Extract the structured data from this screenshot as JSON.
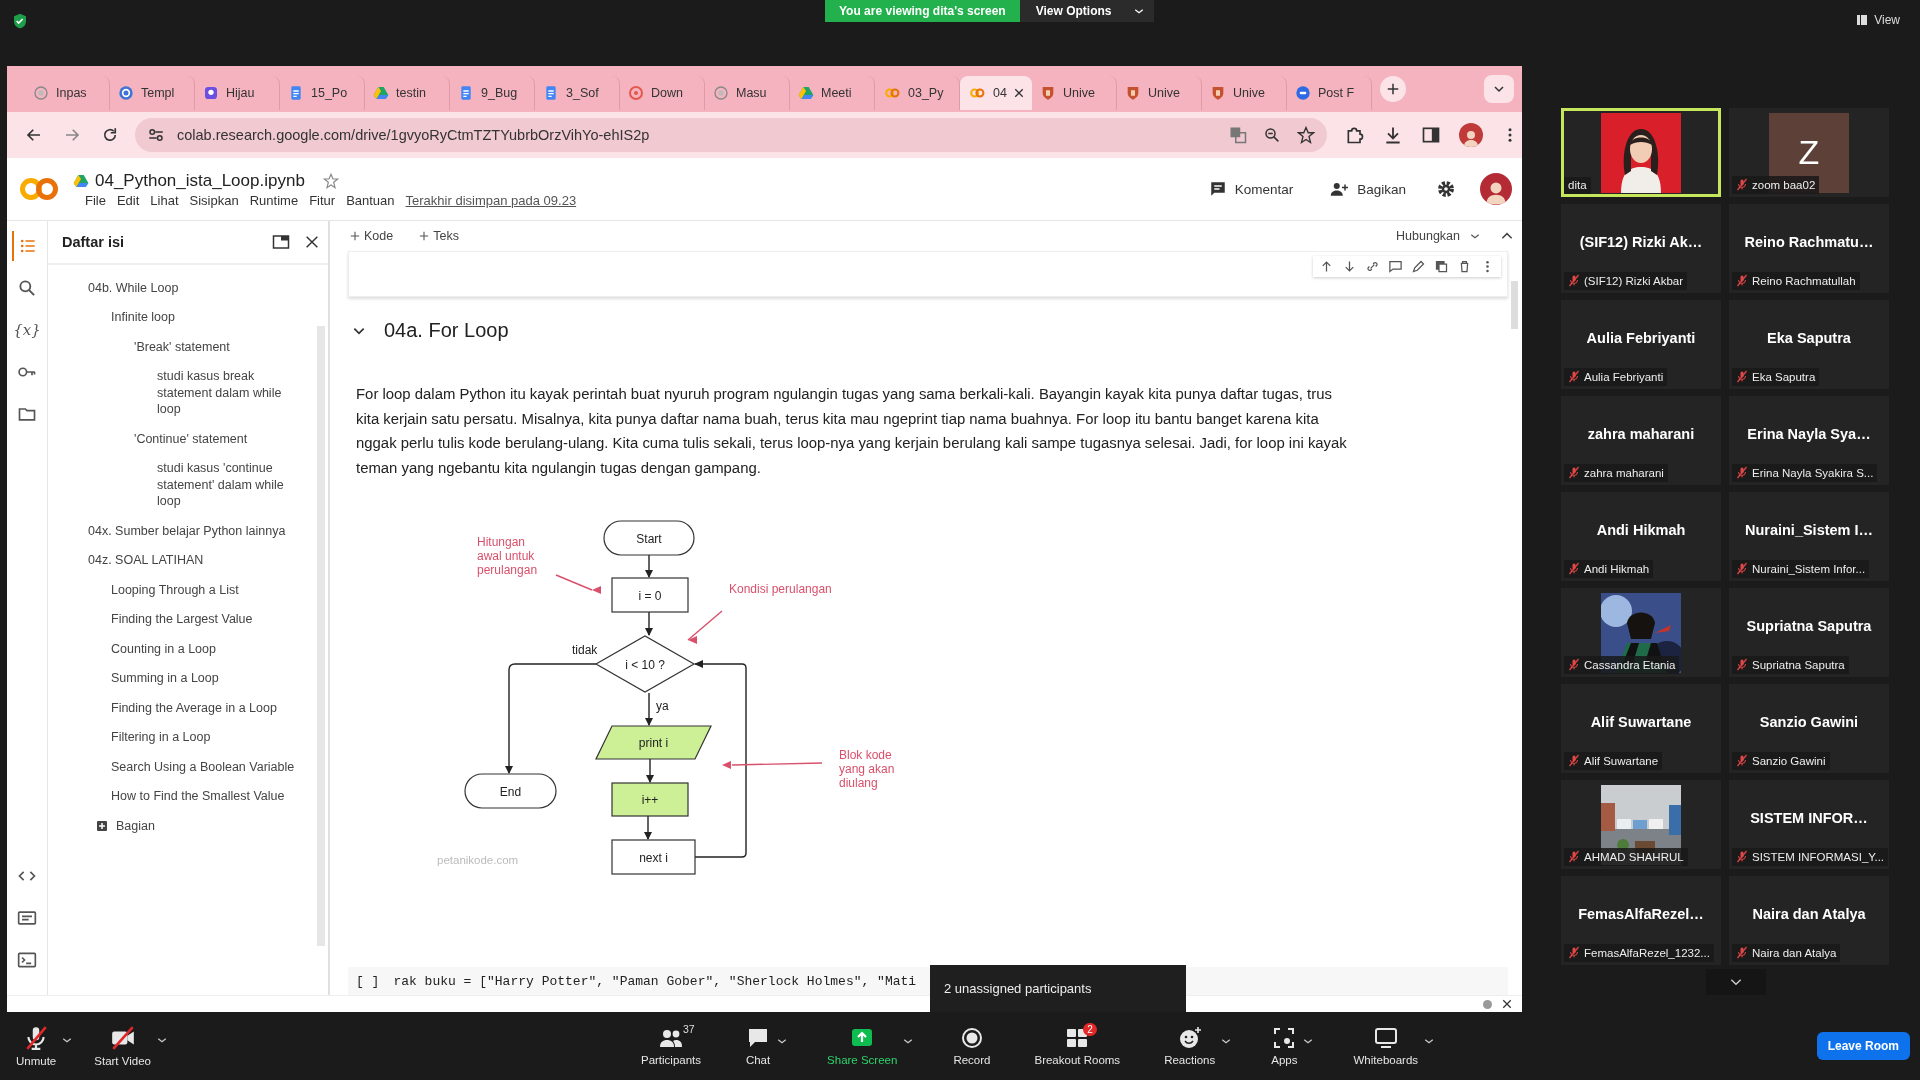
{
  "zoom_bar": {
    "banner": "You are viewing dita's screen",
    "view_options": "View Options",
    "view": "View"
  },
  "browser": {
    "tabs": [
      {
        "kind": "site",
        "label": "Inpas",
        "selected": false
      },
      {
        "kind": "circle",
        "label": "Templ",
        "selected": false
      },
      {
        "kind": "badge",
        "label": "Hijau",
        "selected": false
      },
      {
        "kind": "document",
        "label": "15_Po",
        "selected": false
      },
      {
        "kind": "drive",
        "label": "testin",
        "selected": false
      },
      {
        "kind": "document",
        "label": "9_Bug",
        "selected": false
      },
      {
        "kind": "document",
        "label": "3_Sof",
        "selected": false
      },
      {
        "kind": "ring",
        "label": "Down",
        "selected": false
      },
      {
        "kind": "site",
        "label": "Masu",
        "selected": false
      },
      {
        "kind": "drive",
        "label": "Meeti",
        "selected": false
      },
      {
        "kind": "notebook",
        "label": "03_Py",
        "selected": false
      },
      {
        "kind": "notebook",
        "label": "04",
        "selected": true
      },
      {
        "kind": "shield",
        "label": "Unive",
        "selected": false
      },
      {
        "kind": "shield",
        "label": "Unive",
        "selected": false
      },
      {
        "kind": "shield",
        "label": "Unive",
        "selected": false
      },
      {
        "kind": "meeting",
        "label": "Post F",
        "selected": false
      }
    ],
    "url": "colab.research.google.com/drive/1gvyoRyCtmTZTYubrbOrzVihYo-ehIS2p"
  },
  "notebook": {
    "title": "04_Python_ista_Loop.ipynb",
    "menu": [
      "File",
      "Edit",
      "Lihat",
      "Sisipkan",
      "Runtime",
      "Fitur",
      "Bantuan"
    ],
    "saved": "Terakhir disimpan pada 09.23",
    "comment": "Komentar",
    "share": "Bagikan",
    "add_buttons": [
      "Kode",
      "Teks"
    ],
    "connect": "Hubungkan"
  },
  "sidebar": {
    "rail": [
      {
        "kind": "toc",
        "selected": true
      },
      {
        "kind": "search",
        "selected": false
      },
      {
        "kind": "variables",
        "glyph": "{x}",
        "selected": false
      },
      {
        "kind": "secrets",
        "selected": false
      },
      {
        "kind": "files",
        "selected": false
      },
      {
        "kind": "snippets",
        "selected": false
      },
      {
        "kind": "palette",
        "selected": false
      },
      {
        "kind": "terminal",
        "selected": false
      }
    ],
    "title": "Daftar isi",
    "items": [
      {
        "label": "04b. While Loop",
        "children": [
          {
            "label": "Infinite loop",
            "children": [
              {
                "label": "'Break' statement",
                "children": [
                  {
                    "label": "studi kasus break statement dalam while loop"
                  }
                ]
              },
              {
                "label": "'Continue' statement",
                "children": [
                  {
                    "label": "studi kasus 'continue statement' dalam while loop"
                  }
                ]
              }
            ]
          }
        ]
      },
      {
        "label": "04x. Sumber belajar Python lainnya"
      },
      {
        "label": "04z. SOAL LATIHAN",
        "children": [
          {
            "label": "Looping Through a List"
          },
          {
            "label": "Finding the Largest Value"
          },
          {
            "label": "Counting in a Loop"
          },
          {
            "label": "Summing in a Loop"
          },
          {
            "label": "Finding the Average in a Loop"
          },
          {
            "label": "Filtering in a Loop"
          },
          {
            "label": "Search Using a Boolean Variable"
          },
          {
            "label": "How to Find the Smallest Value"
          }
        ]
      }
    ],
    "add_section": "Bagian"
  },
  "section": {
    "heading": "04a. For Loop",
    "expanded": true,
    "paragraph": "For loop dalam Python itu kayak perintah buat nyuruh program ngulangin tugas yang sama berkali-kali. Bayangin kayak kita punya daftar tugas, trus kita kerjain satu persatu. Misalnya, kita punya daftar nama buah, terus kita mau ngeprint tiap nama buahnya. For loop itu bantu banget karena kita nggak perlu tulis kode berulang-ulang. Kita cuma tulis sekali, terus loop-nya yang kerjain berulang kali sampe tugasnya selesai. Jadi, for loop ini kayak teman yang ngebantu kita ngulangin tugas dengan gampang.",
    "diagram": {
      "nodes": [
        {
          "kind": "terminal",
          "label": "Start",
          "highlighted": false
        },
        {
          "kind": "process",
          "label": "i = 0",
          "highlighted": false
        },
        {
          "kind": "decision",
          "label": "i < 10 ?",
          "highlighted": false
        },
        {
          "kind": "io",
          "label": "print i",
          "highlighted": true
        },
        {
          "kind": "process",
          "label": "i++",
          "highlighted": true
        },
        {
          "kind": "process",
          "label": "next i",
          "highlighted": false
        },
        {
          "kind": "terminal",
          "label": "End",
          "highlighted": false
        }
      ],
      "branch_labels": [
        "tidak",
        "ya"
      ],
      "notes": [
        {
          "lines": [
            "Hitungan",
            "awal untuk",
            "perulangan"
          ]
        },
        {
          "lines": [
            "Kondisi perulangan"
          ]
        },
        {
          "lines": [
            "Blok kode",
            "yang akan",
            "diulang"
          ]
        }
      ],
      "credit": "petanikode.com"
    },
    "code": {
      "prompt": "[ ]",
      "text": "rak buku = [\"Harry Potter\", \"Paman Gober\", \"Sherlock Holmes\", \"Mati"
    }
  },
  "participants": [
    {
      "kind": "picture",
      "label": "dita",
      "selected": true,
      "muted": false
    },
    {
      "kind": "letter",
      "display": "Z",
      "label": "zoom baa02",
      "selected": false,
      "muted": true
    },
    {
      "kind": "name",
      "display": "(SIF12) Rizki Ak…",
      "label": "(SIF12) Rizki Akbar",
      "selected": false,
      "muted": true
    },
    {
      "kind": "name",
      "display": "Reino Rachmatu…",
      "label": "Reino Rachmatullah",
      "selected": false,
      "muted": true
    },
    {
      "kind": "name",
      "display": "Aulia Febriyanti",
      "label": "Aulia Febriyanti",
      "selected": false,
      "muted": true
    },
    {
      "kind": "name",
      "display": "Eka Saputra",
      "label": "Eka Saputra",
      "selected": false,
      "muted": true
    },
    {
      "kind": "name",
      "display": "zahra maharani",
      "label": "zahra maharani",
      "selected": false,
      "muted": true
    },
    {
      "kind": "name",
      "display": "Erina Nayla Sya…",
      "label": "Erina Nayla Syakira S...",
      "selected": false,
      "muted": true
    },
    {
      "kind": "name",
      "display": "Andi Hikmah",
      "label": "Andi Hikmah",
      "selected": false,
      "muted": true
    },
    {
      "kind": "name",
      "display": "Nuraini_Sistem I…",
      "label": "Nuraini_Sistem Infor...",
      "selected": false,
      "muted": true
    },
    {
      "kind": "picture",
      "label": "Cassandra Etania",
      "selected": false,
      "muted": true
    },
    {
      "kind": "name",
      "display": "Supriatna Saputra",
      "label": "Supriatna Saputra",
      "selected": false,
      "muted": true
    },
    {
      "kind": "name",
      "display": "Alif Suwartane",
      "label": "Alif Suwartane",
      "selected": false,
      "muted": true
    },
    {
      "kind": "name",
      "display": "Sanzio Gawini",
      "label": "Sanzio Gawini",
      "selected": false,
      "muted": true
    },
    {
      "kind": "picture",
      "label": "AHMAD SHAHRUL",
      "selected": false,
      "muted": true
    },
    {
      "kind": "name",
      "display": "SISTEM INFOR…",
      "label": "SISTEM INFORMASI_Y...",
      "selected": false,
      "muted": true
    },
    {
      "kind": "name",
      "display": "FemasAlfaRezel…",
      "label": "FemasAlfaRezel_1232...",
      "selected": false,
      "muted": true
    },
    {
      "kind": "name",
      "display": "Naira dan Atalya",
      "label": "Naira dan Atalya",
      "selected": false,
      "muted": true
    }
  ],
  "toolbar": {
    "items": [
      {
        "kind": "mic",
        "label": "Unmute",
        "caret": true
      },
      {
        "kind": "video",
        "label": "Start Video",
        "caret": true
      },
      {
        "kind": "people",
        "label": "Participants",
        "count": "37",
        "caret": false
      },
      {
        "kind": "chat",
        "label": "Chat",
        "caret": true
      },
      {
        "kind": "share",
        "label": "Share Screen",
        "caret": true
      },
      {
        "kind": "record",
        "label": "Record",
        "caret": false
      },
      {
        "kind": "breakout",
        "label": "Breakout Rooms",
        "badge": "2",
        "caret": false
      },
      {
        "kind": "reactions",
        "label": "Reactions",
        "caret": true
      },
      {
        "kind": "apps",
        "label": "Apps",
        "caret": true
      },
      {
        "kind": "whiteboard",
        "label": "Whiteboards",
        "caret": true
      }
    ],
    "leave": "Leave Room"
  },
  "tooltip": "2 unassigned participants"
}
